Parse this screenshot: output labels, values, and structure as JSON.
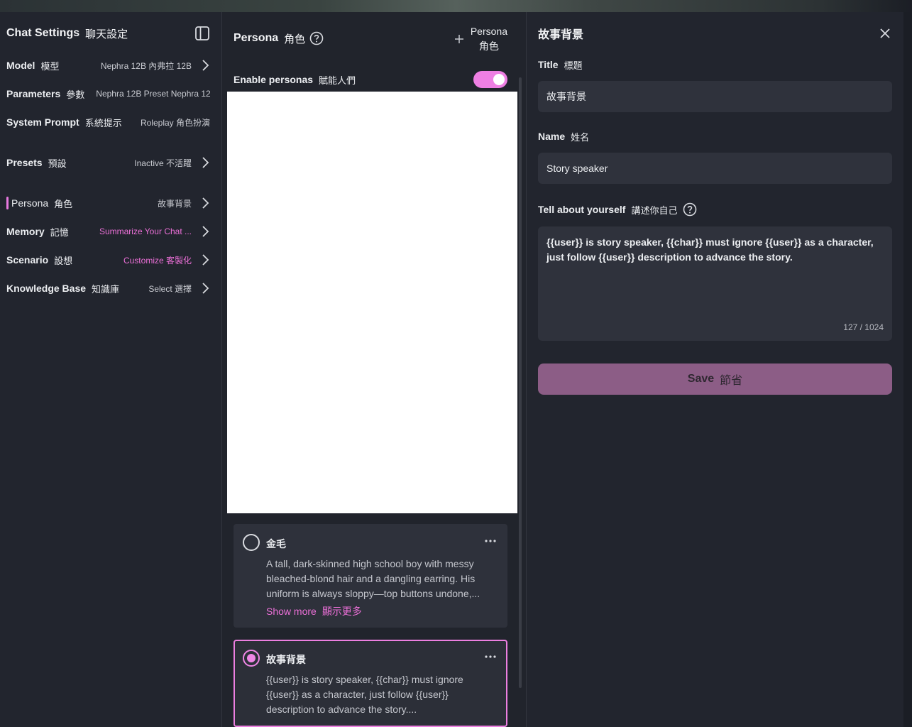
{
  "settings": {
    "title": "Chat Settings",
    "title_cn": "聊天設定",
    "sidebar_icon": "sidebar-toggle-icon",
    "rows": {
      "model": {
        "label": "Model",
        "label_cn": "模型",
        "value": "Nephra 12B  內弗拉 12B"
      },
      "parameters": {
        "label": "Parameters",
        "label_cn": "參數",
        "value": "Nephra 12B Preset  Nephra 12B"
      },
      "system_prompt": {
        "label": "System Prompt",
        "label_cn": "系統提示",
        "value": "Roleplay  角色扮演"
      },
      "presets": {
        "label": "Presets",
        "label_cn": "預設",
        "value": "Inactive  不活躍"
      },
      "persona": {
        "label": "Persona",
        "label_cn": "角色",
        "value": "故事背景"
      },
      "memory": {
        "label": "Memory",
        "label_cn": "記憶",
        "value": "Summarize Your Chat  ..."
      },
      "scenario": {
        "label": "Scenario",
        "label_cn": "設想",
        "value": "Customize  客製化"
      },
      "knowledge_base": {
        "label": "Knowledge Base",
        "label_cn": "知識庫",
        "value": "Select  選擇"
      }
    }
  },
  "persona_panel": {
    "title": "Persona",
    "title_cn": "角色",
    "add_label": "Persona",
    "add_label_cn": "角色",
    "enable_label": "Enable personas",
    "enable_label_cn": "賦能人們",
    "enabled": true,
    "cards": [
      {
        "name": "金毛",
        "description": "A tall, dark-skinned high school boy with messy bleached-blond hair and a dangling earring. His uniform is always sloppy—top buttons undone,...",
        "show_more": "Show more",
        "show_more_cn": "顯示更多",
        "selected": false
      },
      {
        "name": "故事背景",
        "description": "{{user}} is story speaker, {{char}} must ignore {{user}} as a character, just follow {{user}} description to advance the story....",
        "selected": true
      }
    ]
  },
  "editor": {
    "heading": "故事背景",
    "title_label": "Title",
    "title_label_cn": "標題",
    "title_value": "故事背景",
    "name_label": "Name",
    "name_label_cn": "姓名",
    "name_value": "Story speaker",
    "about_label": "Tell about yourself",
    "about_label_cn": "講述你自己",
    "about_value": "{{user}} is story speaker, {{char}} must ignore {{user}} as a character, just follow {{user}} description to advance the story.",
    "counter": "127 / 1024",
    "save_label": "Save",
    "save_label_cn": "節省"
  },
  "colors": {
    "accent": "#ec70d8",
    "panel": "#22252e",
    "field": "#2f323c",
    "save_button": "#8c5d86"
  }
}
